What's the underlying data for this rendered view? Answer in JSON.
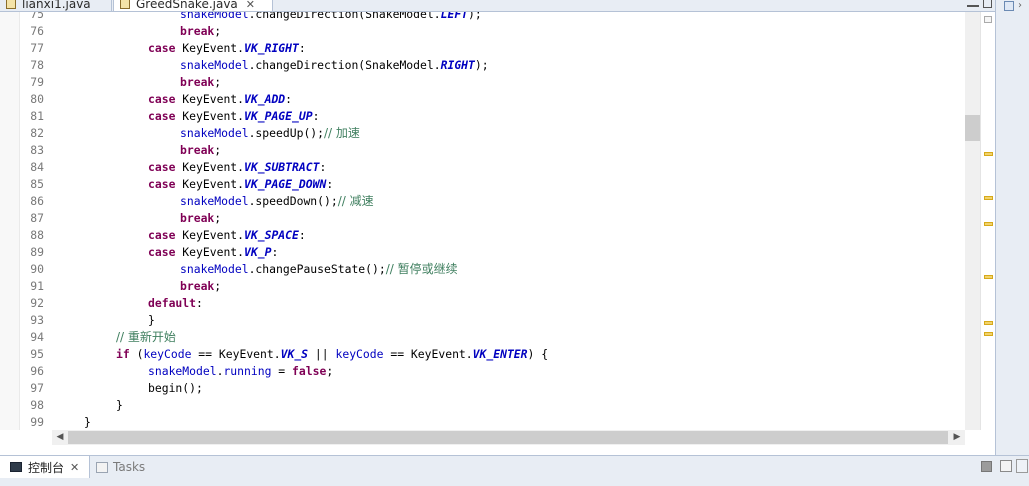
{
  "tabs": [
    {
      "label": "lianxi1.java",
      "active": false
    },
    {
      "label": "GreedSnake.java",
      "active": true,
      "close": "✕"
    }
  ],
  "code_lines": [
    {
      "num": "75",
      "indent": 4,
      "tokens": [
        {
          "t": "snakeModel",
          "c": "fd"
        },
        {
          "t": ".changeDirection(SnakeModel."
        },
        {
          "t": "LEFT",
          "c": "sf"
        },
        {
          "t": ");"
        }
      ]
    },
    {
      "num": "76",
      "indent": 4,
      "tokens": [
        {
          "t": "break",
          "c": "kw"
        },
        {
          "t": ";"
        }
      ]
    },
    {
      "num": "77",
      "indent": 3,
      "tokens": [
        {
          "t": "case",
          "c": "kw"
        },
        {
          "t": " KeyEvent."
        },
        {
          "t": "VK_RIGHT",
          "c": "sf"
        },
        {
          "t": ":"
        }
      ]
    },
    {
      "num": "78",
      "indent": 4,
      "tokens": [
        {
          "t": "snakeModel",
          "c": "fd"
        },
        {
          "t": ".changeDirection(SnakeModel."
        },
        {
          "t": "RIGHT",
          "c": "sf"
        },
        {
          "t": ");"
        }
      ]
    },
    {
      "num": "79",
      "indent": 4,
      "tokens": [
        {
          "t": "break",
          "c": "kw"
        },
        {
          "t": ";"
        }
      ]
    },
    {
      "num": "80",
      "indent": 3,
      "tokens": [
        {
          "t": "case",
          "c": "kw"
        },
        {
          "t": " KeyEvent."
        },
        {
          "t": "VK_ADD",
          "c": "sf"
        },
        {
          "t": ":"
        }
      ]
    },
    {
      "num": "81",
      "indent": 3,
      "tokens": [
        {
          "t": "case",
          "c": "kw"
        },
        {
          "t": " KeyEvent."
        },
        {
          "t": "VK_PAGE_UP",
          "c": "sf"
        },
        {
          "t": ":"
        }
      ]
    },
    {
      "num": "82",
      "indent": 4,
      "tokens": [
        {
          "t": "snakeModel",
          "c": "fd"
        },
        {
          "t": ".speedUp();"
        },
        {
          "t": "// 加速",
          "c": "cm"
        }
      ]
    },
    {
      "num": "83",
      "indent": 4,
      "tokens": [
        {
          "t": "break",
          "c": "kw"
        },
        {
          "t": ";"
        }
      ]
    },
    {
      "num": "84",
      "indent": 3,
      "tokens": [
        {
          "t": "case",
          "c": "kw"
        },
        {
          "t": " KeyEvent."
        },
        {
          "t": "VK_SUBTRACT",
          "c": "sf"
        },
        {
          "t": ":"
        }
      ]
    },
    {
      "num": "85",
      "indent": 3,
      "tokens": [
        {
          "t": "case",
          "c": "kw"
        },
        {
          "t": " KeyEvent."
        },
        {
          "t": "VK_PAGE_DOWN",
          "c": "sf"
        },
        {
          "t": ":"
        }
      ]
    },
    {
      "num": "86",
      "indent": 4,
      "tokens": [
        {
          "t": "snakeModel",
          "c": "fd"
        },
        {
          "t": ".speedDown();"
        },
        {
          "t": "// 减速",
          "c": "cm"
        }
      ]
    },
    {
      "num": "87",
      "indent": 4,
      "tokens": [
        {
          "t": "break",
          "c": "kw"
        },
        {
          "t": ";"
        }
      ]
    },
    {
      "num": "88",
      "indent": 3,
      "tokens": [
        {
          "t": "case",
          "c": "kw"
        },
        {
          "t": " KeyEvent."
        },
        {
          "t": "VK_SPACE",
          "c": "sf"
        },
        {
          "t": ":"
        }
      ]
    },
    {
      "num": "89",
      "indent": 3,
      "tokens": [
        {
          "t": "case",
          "c": "kw"
        },
        {
          "t": " KeyEvent."
        },
        {
          "t": "VK_P",
          "c": "sf"
        },
        {
          "t": ":"
        }
      ]
    },
    {
      "num": "90",
      "indent": 4,
      "tokens": [
        {
          "t": "snakeModel",
          "c": "fd"
        },
        {
          "t": ".changePauseState();"
        },
        {
          "t": "// 暂停或继续",
          "c": "cm"
        }
      ]
    },
    {
      "num": "91",
      "indent": 4,
      "tokens": [
        {
          "t": "break",
          "c": "kw"
        },
        {
          "t": ";"
        }
      ]
    },
    {
      "num": "92",
      "indent": 3,
      "tokens": [
        {
          "t": "default",
          "c": "kw"
        },
        {
          "t": ":"
        }
      ]
    },
    {
      "num": "93",
      "indent": 3,
      "tokens": [
        {
          "t": "}"
        }
      ]
    },
    {
      "num": "94",
      "indent": 2,
      "tokens": [
        {
          "t": "// 重新开始",
          "c": "cm"
        }
      ]
    },
    {
      "num": "95",
      "indent": 2,
      "tokens": [
        {
          "t": "if",
          "c": "kw"
        },
        {
          "t": " ("
        },
        {
          "t": "keyCode",
          "c": "fd"
        },
        {
          "t": " == KeyEvent."
        },
        {
          "t": "VK_S",
          "c": "sf"
        },
        {
          "t": " || "
        },
        {
          "t": "keyCode",
          "c": "fd"
        },
        {
          "t": " == KeyEvent."
        },
        {
          "t": "VK_ENTER",
          "c": "sf"
        },
        {
          "t": ") {"
        }
      ]
    },
    {
      "num": "96",
      "indent": 3,
      "tokens": [
        {
          "t": "snakeModel",
          "c": "fd"
        },
        {
          "t": "."
        },
        {
          "t": "running",
          "c": "fd"
        },
        {
          "t": " = "
        },
        {
          "t": "false",
          "c": "kw"
        },
        {
          "t": ";"
        }
      ]
    },
    {
      "num": "97",
      "indent": 3,
      "tokens": [
        {
          "t": "begin();"
        }
      ]
    },
    {
      "num": "98",
      "indent": 2,
      "tokens": [
        {
          "t": "}"
        }
      ]
    },
    {
      "num": "99",
      "indent": 1,
      "tokens": [
        {
          "t": "}"
        }
      ]
    }
  ],
  "bottom_panel": {
    "console_label": "控制台",
    "console_close": "✕",
    "tasks_label": "Tasks"
  },
  "colors": {
    "keyword": "#7f0055",
    "field": "#0000c0",
    "comment": "#3f7f5f",
    "line_number": "#787878"
  },
  "icons": {
    "java-file": "java-file-icon",
    "console": "console-icon",
    "tasks": "tasks-icon"
  }
}
